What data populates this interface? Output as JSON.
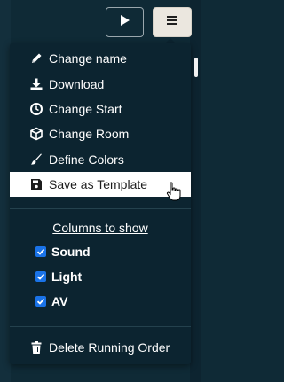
{
  "toolbar": {
    "play_icon": "play-icon",
    "menu_icon": "hamburger-icon"
  },
  "menu": {
    "items": [
      {
        "label": "Change name",
        "icon": "pencil-icon"
      },
      {
        "label": "Download",
        "icon": "download-icon"
      },
      {
        "label": "Change Start",
        "icon": "clock-icon"
      },
      {
        "label": "Change Room",
        "icon": "cube-icon"
      },
      {
        "label": "Define Colors",
        "icon": "brush-icon"
      },
      {
        "label": "Save as Template",
        "icon": "save-icon"
      }
    ],
    "columns_title": "Columns to show",
    "columns": [
      {
        "label": "Sound",
        "checked": true
      },
      {
        "label": "Light",
        "checked": true
      },
      {
        "label": "AV",
        "checked": true
      }
    ],
    "delete_label": "Delete Running Order",
    "delete_icon": "trash-icon"
  },
  "colors": {
    "background": "#0f2a36",
    "menu_bg": "#0c2430",
    "hover_bg": "#ffffff",
    "checkbox": "#1a73e8"
  }
}
